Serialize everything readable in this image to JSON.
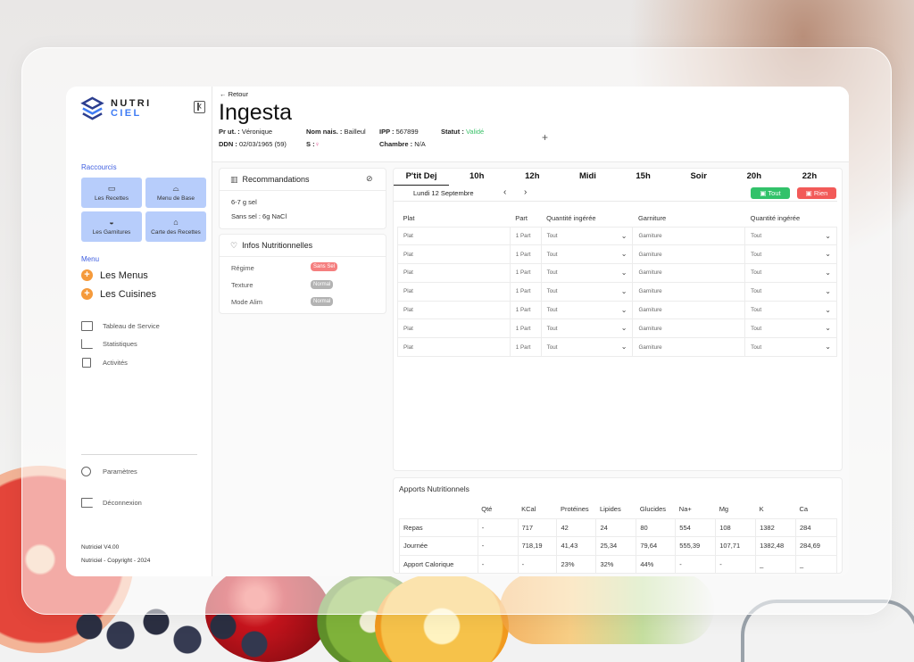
{
  "app": {
    "logo_top": "NUTRI",
    "logo_bottom": "CIEL"
  },
  "sidebar": {
    "shortcuts_title": "Raccourcis",
    "shortcuts": [
      {
        "label": "Les Recettes",
        "icon": "pot-icon"
      },
      {
        "label": "Menu de Base",
        "icon": "dish-icon"
      },
      {
        "label": "Les Garnitures",
        "icon": "salad-icon"
      },
      {
        "label": "Carte des Recettes",
        "icon": "chef-hat-icon"
      }
    ],
    "menu_title": "Menu",
    "menu": [
      {
        "label": "Les Menus"
      },
      {
        "label": "Les Cuisines"
      }
    ],
    "nav": [
      {
        "label": "Tableau de Service",
        "icon": "table-icon"
      },
      {
        "label": "Statistiques",
        "icon": "chart-icon"
      },
      {
        "label": "Activités",
        "icon": "clipboard-icon"
      }
    ],
    "settings": "Paramètres",
    "logout": "Déconnexion",
    "version": "Nutriciel V4.00",
    "copyright": "Nutriciel - Copyright - 2024"
  },
  "header": {
    "back": "Retour",
    "title": "Ingesta",
    "pr_ut_label": "Pr ut. :",
    "pr_ut_value": "Véronique",
    "nom_nais_label": "Nom nais. :",
    "nom_nais_value": "Bailleul",
    "ipp_label": "IPP :",
    "ipp_value": "567899",
    "statut_label": "Statut :",
    "statut_value": "Validé",
    "ddn_label": "DDN :",
    "ddn_value": "02/03/1965 (59)",
    "sexe_label": "S :",
    "sexe_value": "♀",
    "chambre_label": "Chambre :",
    "chambre_value": "N/A",
    "plus": "+"
  },
  "recommandations": {
    "title": "Recommandations",
    "lines": [
      "6-7 g sel",
      "Sans sel : 6g NaCl"
    ]
  },
  "infos": {
    "title": "Infos Nutritionnelles",
    "rows": [
      {
        "label": "Régime",
        "value": "Sans Sel",
        "color": "#f57f7f"
      },
      {
        "label": "Texture",
        "value": "Normal",
        "color": "#b3b3b3"
      },
      {
        "label": "Mode Alim",
        "value": "Normal",
        "color": "#b3b3b3"
      }
    ]
  },
  "meal": {
    "tabs": [
      "P'tit Dej",
      "10h",
      "12h",
      "Midi",
      "15h",
      "Soir",
      "20h",
      "22h"
    ],
    "active_tab": 0,
    "date": "Lundi 12 Septembre",
    "prev": "‹",
    "next": "›",
    "btn_all": "Tout",
    "btn_none": "Rien",
    "columns": [
      "Plat",
      "Part",
      "Quantité ingérée",
      "Garniture",
      "Quantité ingérée"
    ],
    "rows": [
      [
        "Plat",
        "1 Part",
        "Tout",
        "Garniture",
        "Tout"
      ],
      [
        "Plat",
        "1 Part",
        "Tout",
        "Garniture",
        "Tout"
      ],
      [
        "Plat",
        "1 Part",
        "Tout",
        "Garniture",
        "Tout"
      ],
      [
        "Plat",
        "1 Part",
        "Tout",
        "Garniture",
        "Tout"
      ],
      [
        "Plat",
        "1 Part",
        "Tout",
        "Garniture",
        "Tout"
      ],
      [
        "Plat",
        "1 Part",
        "Tout",
        "Garniture",
        "Tout"
      ],
      [
        "Plat",
        "1 Part",
        "Tout",
        "Garniture",
        "Tout"
      ]
    ]
  },
  "apports": {
    "title": "Apports Nutritionnels",
    "columns": [
      "",
      "Qté",
      "KCal",
      "Protéines",
      "Lipides",
      "Glucides",
      "Na+",
      "Mg",
      "K",
      "Ca"
    ],
    "rows": [
      [
        "Repas",
        "-",
        "717",
        "42",
        "24",
        "80",
        "554",
        "108",
        "1382",
        "284"
      ],
      [
        "Journée",
        "-",
        "718,19",
        "41,43",
        "25,34",
        "79,64",
        "555,39",
        "107,71",
        "1382,48",
        "284,69"
      ],
      [
        "Apport Calorique",
        "-",
        "-",
        "23%",
        "32%",
        "44%",
        "-",
        "-",
        "_",
        "_"
      ]
    ]
  },
  "colors": {
    "accent": "#3f7cf4",
    "shortcut_bg": "#b7cdfb",
    "plus": "#f59a3b",
    "tout": "#32c26a",
    "rien": "#f25a58",
    "valid": "#3dc26b"
  }
}
